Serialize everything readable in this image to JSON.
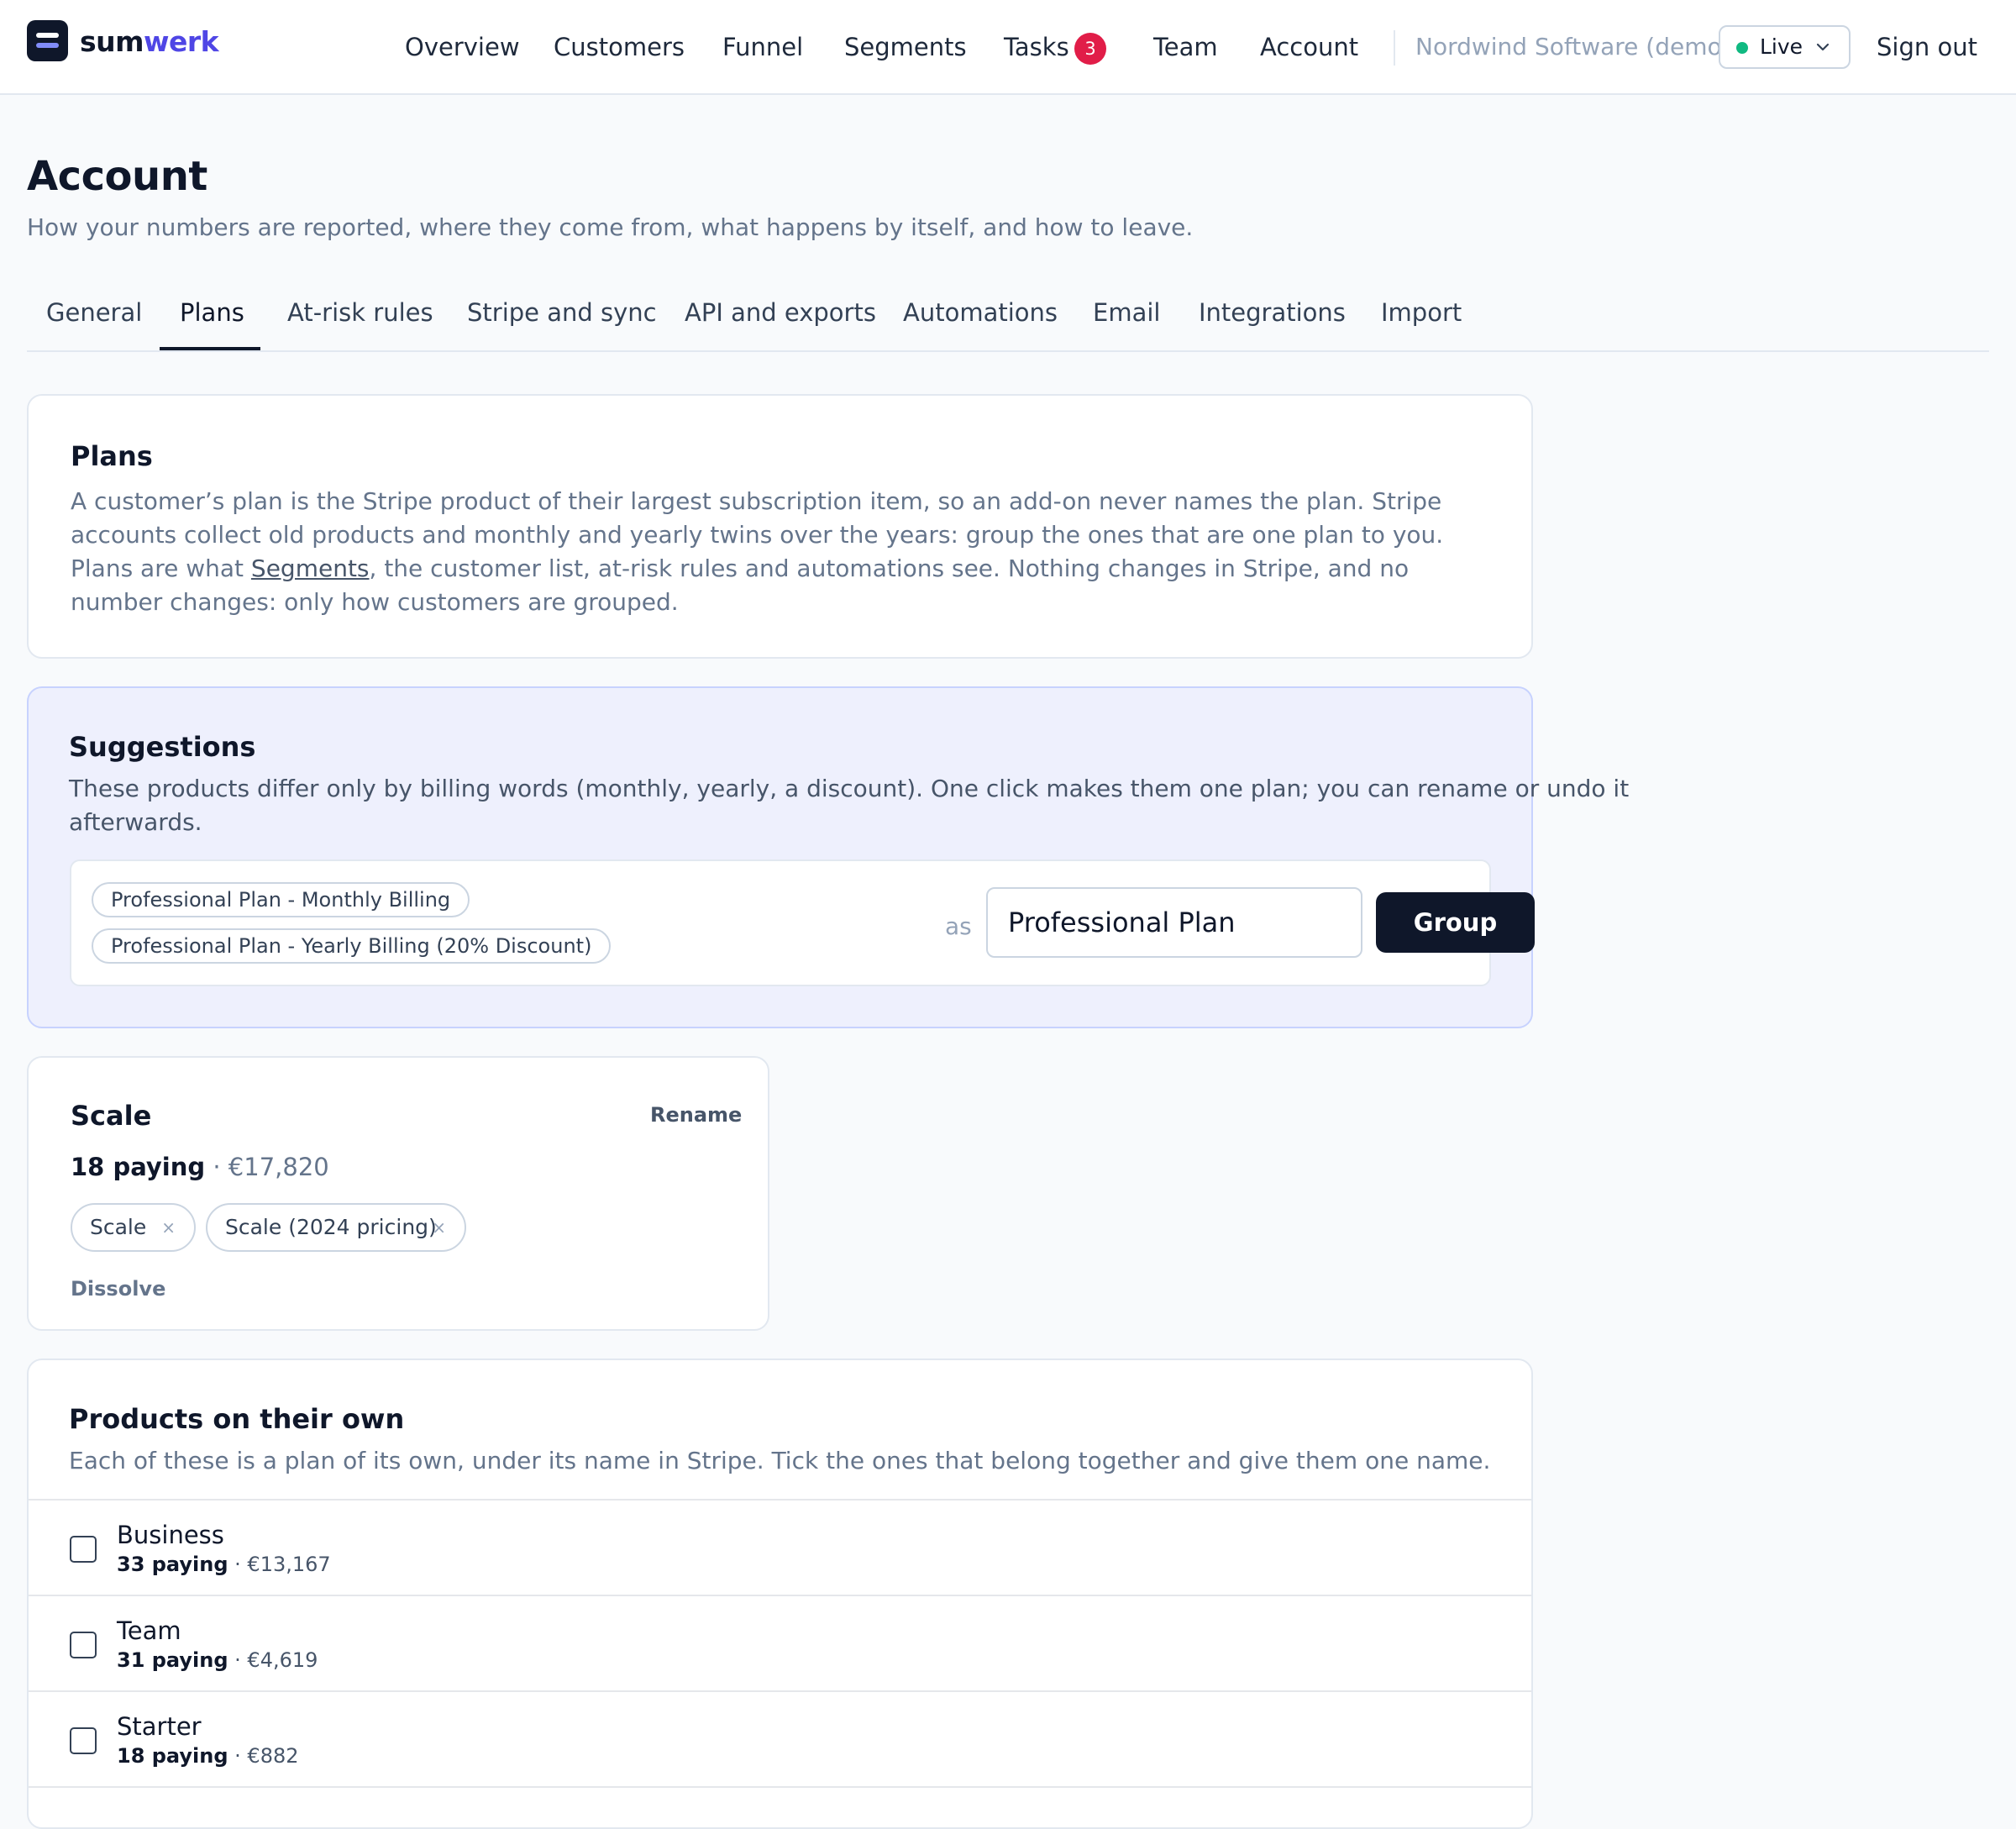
{
  "brand": {
    "part1": "sum",
    "part2": "werk"
  },
  "nav": {
    "items": [
      "Overview",
      "Customers",
      "Funnel",
      "Segments",
      "Tasks",
      "Team",
      "Account"
    ],
    "tasks_badge": "3",
    "org_name": "Nordwind Software (demo)",
    "mode_label": "Live",
    "sign_out": "Sign out"
  },
  "header": {
    "title": "Account",
    "subtitle": "How your numbers are reported, where they come from, what happens by itself, and how to leave."
  },
  "tabs": [
    "General",
    "Plans",
    "At-risk rules",
    "Stripe and sync",
    "API and exports",
    "Automations",
    "Email",
    "Integrations",
    "Import"
  ],
  "active_tab": "Plans",
  "plans_intro": {
    "title": "Plans",
    "line1": "A customer’s plan is the Stripe product of their largest subscription item, so an add-on never names the plan. Stripe",
    "line2": "accounts collect old products and monthly and yearly twins over the years: group the ones that are one plan to you.",
    "line3_before": "Plans are what ",
    "line3_link": "Segments",
    "line3_after": ", the customer list, at-risk rules and automations see. Nothing changes in Stripe, and no",
    "line4": "number changes: only how customers are grouped."
  },
  "suggestions": {
    "title": "Suggestions",
    "line1": "These products differ only by billing words (monthly, yearly, a discount). One click makes them one plan; you can rename or undo it",
    "line2": "afterwards.",
    "products": [
      "Professional Plan - Monthly Billing",
      "Professional Plan - Yearly Billing (20% Discount)"
    ],
    "as_label": "as",
    "group_name": "Professional Plan",
    "group_button": "Group"
  },
  "plan_group": {
    "name": "Scale",
    "rename": "Rename",
    "paying": "18 paying",
    "separator": " · ",
    "revenue": "€17,820",
    "products": [
      "Scale",
      "Scale (2024 pricing)"
    ],
    "remove_glyph": "×",
    "dissolve": "Dissolve"
  },
  "own_products": {
    "title": "Products on their own",
    "description": "Each of these is a plan of its own, under its name in Stripe. Tick the ones that belong together and give them one name.",
    "rows": [
      {
        "name": "Business",
        "paying": "33 paying",
        "revenue": "€13,167",
        "checked": false
      },
      {
        "name": "Team",
        "paying": "31 paying",
        "revenue": "€4,619",
        "checked": false
      },
      {
        "name": "Starter",
        "paying": "18 paying",
        "revenue": "€882",
        "checked": false
      }
    ],
    "separator": " · "
  },
  "colors": {
    "primary": "#0f172a",
    "accent": "#4f46e5",
    "badge": "#e11d48",
    "live": "#10b981",
    "suggestion_bg": "#eef0fd"
  },
  "icons": [
    "logo-icon",
    "chevron-down-icon",
    "status-dot-icon",
    "close-icon",
    "checkbox-icon"
  ]
}
